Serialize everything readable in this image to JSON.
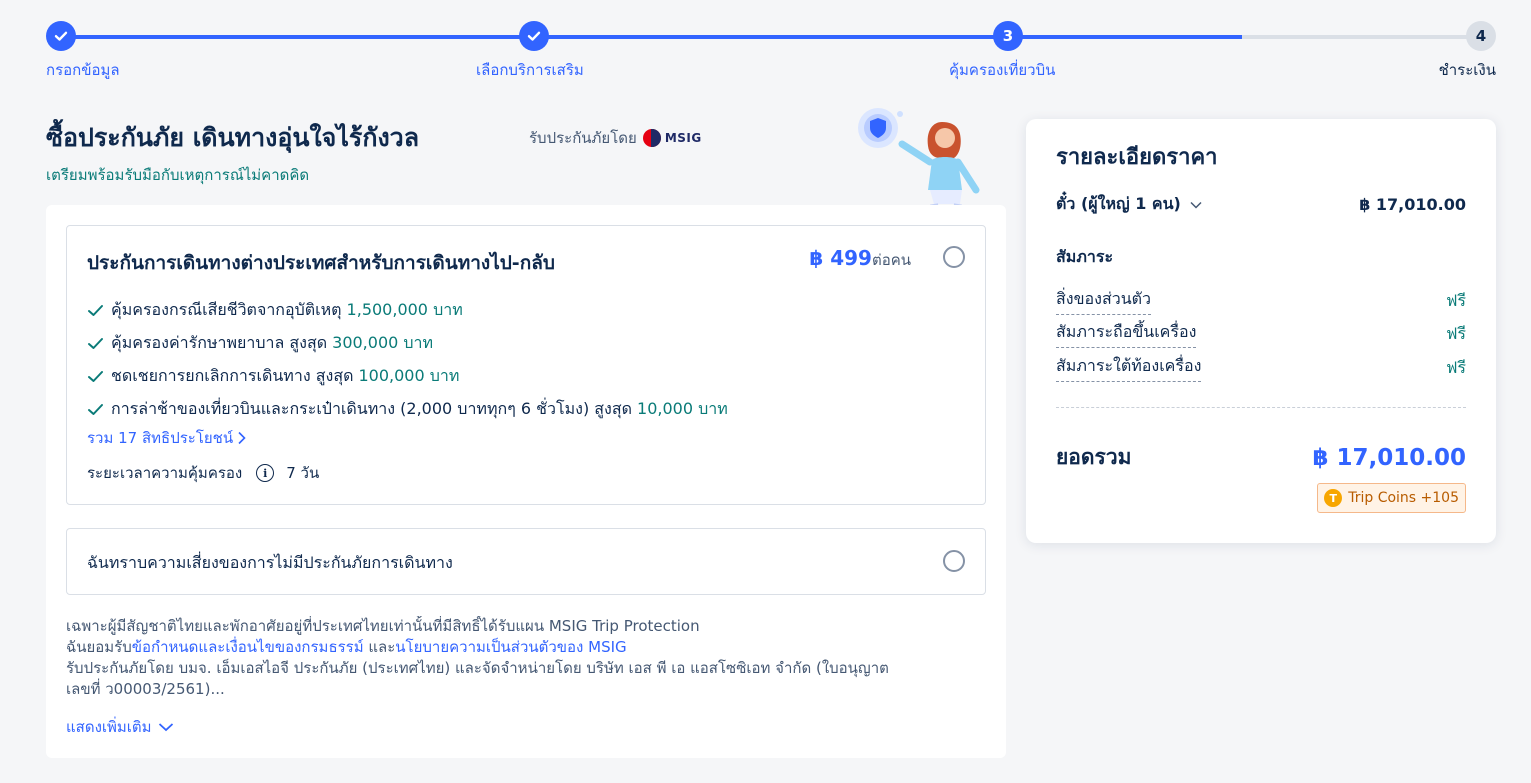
{
  "stepper": {
    "steps": [
      {
        "number": "",
        "label": "กรอกข้อมูล",
        "state": "done"
      },
      {
        "number": "",
        "label": "เลือกบริการเสริม",
        "state": "done"
      },
      {
        "number": "3",
        "label": "คุ้มครองเที่ยวบิน",
        "state": "active"
      },
      {
        "number": "4",
        "label": "ชำระเงิน",
        "state": "todo"
      }
    ]
  },
  "header": {
    "title": "ซื้อประกันภัย เดินทางอุ่นใจไร้กังวล",
    "underwritten_by": "รับประกันภัยโดย",
    "insurer_logo_text": "MSIG",
    "subtitle": "เตรียมพร้อมรับมือกับเหตุการณ์ไม่คาดคิด"
  },
  "plan": {
    "name": "ประกันการเดินทางต่างประเทศสำหรับการเดินทางไป-กลับ",
    "price": "฿ 499",
    "price_unit": "ต่อคน",
    "benefits": [
      {
        "text": "คุ้มครองกรณีเสียชีวิตจากอุบัติเหตุ",
        "highlight": "1,500,000 บาท"
      },
      {
        "text": "คุ้มครองค่ารักษาพยาบาล สูงสุด",
        "highlight": "300,000 บาท"
      },
      {
        "text": "ชดเชยการยกเลิกการเดินทาง สูงสุด",
        "highlight": "100,000 บาท"
      },
      {
        "text": "การล่าช้าของเที่ยวบินและกระเป๋าเดินทาง (2,000 บาททุกๆ 6 ชั่วโมง) สูงสุด",
        "highlight": "10,000 บาท"
      }
    ],
    "more_benefits": "รวม 17 สิทธิประโยชน์",
    "coverage_label": "ระยะเวลาความคุ้มครอง",
    "coverage_value": "7 วัน"
  },
  "decline": {
    "label": "ฉันทราบความเสี่ยงของการไม่มีประกันภัยการเดินทาง"
  },
  "legal": {
    "line1": "เฉพาะผู้มีสัญชาติไทยและพักอาศัยอยู่ที่ประเทศไทยเท่านั้นที่มีสิทธิ์ได้รับแผน MSIG Trip Protection",
    "line2_prefix": "ฉันยอมรับ",
    "line2_link1": "ข้อกำหนดและเงื่อนไขของกรมธรรม์",
    "line2_mid": " และ",
    "line2_link2": "นโยบายความเป็นส่วนตัวของ MSIG",
    "line3": "รับประกันภัยโดย บมจ. เอ็มเอสไอจี ประกันภัย (ประเทศไทย) และจัดจำหน่ายโดย บริษัท เอส พี เอ แอสโซซิเอท จำกัด (ใบอนุญาต",
    "line4": "เลขที่ ว00003/2561)...",
    "show_more": "แสดงเพิ่มเติม"
  },
  "price_details": {
    "title": "รายละเอียดราคา",
    "ticket_label": "ตั๋ว (ผู้ใหญ่ 1 คน)",
    "ticket_price": "฿ 17,010.00",
    "baggage_heading": "สัมภาระ",
    "baggage": [
      {
        "label": "สิ่งของส่วนตัว",
        "value": "ฟรี"
      },
      {
        "label": "สัมภาระถือขึ้นเครื่อง",
        "value": "ฟรี"
      },
      {
        "label": "สัมภาระใต้ท้องเครื่อง",
        "value": "ฟรี"
      }
    ],
    "total_label": "ยอดรวม",
    "total_value": "฿ 17,010.00",
    "coin_icon_letter": "T",
    "trip_coins": "Trip Coins +105"
  },
  "colors": {
    "primary": "#3264ff",
    "teal": "#0a7b78",
    "text": "#0f294d",
    "muted_track": "#dadfe6"
  },
  "icons": [
    "check-icon",
    "chevron-right-icon",
    "chevron-down-icon",
    "info-icon",
    "radio-icon",
    "coin-icon"
  ]
}
